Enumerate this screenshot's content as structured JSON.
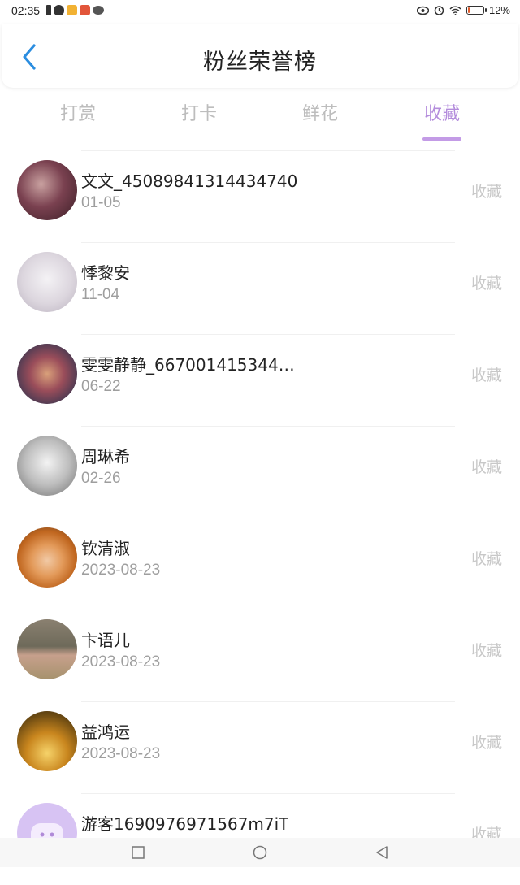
{
  "status_bar": {
    "time": "02:35",
    "battery_level": "12%",
    "battery_fraction": 0.12
  },
  "header": {
    "title": "粉丝荣誉榜",
    "back_icon": "chevron-left-icon",
    "accent_color": "#2a8de0"
  },
  "tabs": [
    {
      "label": "打赏",
      "active": false
    },
    {
      "label": "打卡",
      "active": false
    },
    {
      "label": "鲜花",
      "active": false
    },
    {
      "label": "收藏",
      "active": true
    }
  ],
  "active_tab_color": "#b48ddc",
  "fans": [
    {
      "name": "文文_45089841314434740",
      "date": "01-05",
      "action": "收藏"
    },
    {
      "name": "悸黎安",
      "date": "11-04",
      "action": "收藏"
    },
    {
      "name": "雯雯静静_6670014153443...",
      "date": "06-22",
      "action": "收藏"
    },
    {
      "name": "周琳希",
      "date": "02-26",
      "action": "收藏"
    },
    {
      "name": "钦清淑",
      "date": "2023-08-23",
      "action": "收藏"
    },
    {
      "name": "卞语儿",
      "date": "2023-08-23",
      "action": "收藏"
    },
    {
      "name": "益鸿运",
      "date": "2023-08-23",
      "action": "收藏"
    },
    {
      "name": "游客1690976971567m7iT",
      "date": "",
      "action": "收藏"
    }
  ],
  "nav_bar": {
    "recents_icon": "square-icon",
    "home_icon": "circle-icon",
    "back_icon": "triangle-back-icon"
  }
}
